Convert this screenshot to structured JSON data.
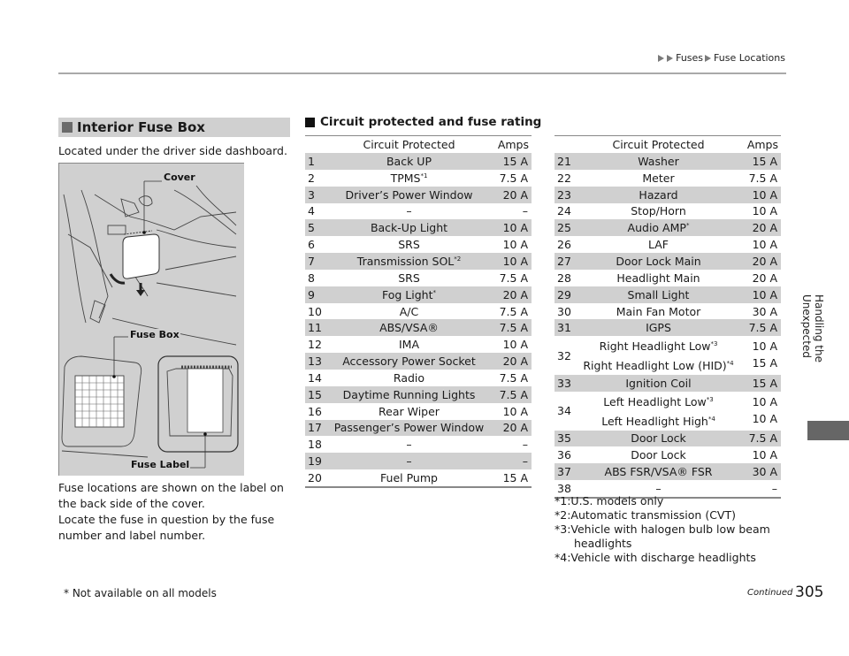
{
  "breadcrumb": {
    "items": [
      "Fuses",
      "Fuse Locations"
    ]
  },
  "left": {
    "section_title": "Interior Fuse Box",
    "intro": "Located under the driver side dashboard.",
    "figure_labels": {
      "cover": "Cover",
      "fuse_box": "Fuse Box",
      "fuse_label": "Fuse Label"
    },
    "notes": [
      "Fuse locations are shown on the label on the back side of the cover.",
      "Locate the fuse in question by the fuse number and label number."
    ]
  },
  "right": {
    "subsection_title": "Circuit protected and fuse rating",
    "columns": {
      "circuit": "Circuit Protected",
      "amps": "Amps"
    },
    "table_left": [
      {
        "num": "1",
        "circuit": "Back UP",
        "amps": "15 A"
      },
      {
        "num": "2",
        "circuit": "TPMS",
        "sup": "*1",
        "amps": "7.5 A"
      },
      {
        "num": "3",
        "circuit": "Driver’s Power Window",
        "amps": "20 A"
      },
      {
        "num": "4",
        "circuit": "–",
        "amps": "–"
      },
      {
        "num": "5",
        "circuit": "Back-Up Light",
        "amps": "10 A"
      },
      {
        "num": "6",
        "circuit": "SRS",
        "amps": "10 A"
      },
      {
        "num": "7",
        "circuit": "Transmission SOL",
        "sup": "*2",
        "amps": "10 A"
      },
      {
        "num": "8",
        "circuit": "SRS",
        "amps": "7.5 A"
      },
      {
        "num": "9",
        "circuit": "Fog Light",
        "sup": "*",
        "amps": "20 A"
      },
      {
        "num": "10",
        "circuit": "A/C",
        "amps": "7.5 A"
      },
      {
        "num": "11",
        "circuit": "ABS/VSA®",
        "amps": "7.5 A"
      },
      {
        "num": "12",
        "circuit": "IMA",
        "amps": "10 A"
      },
      {
        "num": "13",
        "circuit": "Accessory Power Socket",
        "amps": "20 A"
      },
      {
        "num": "14",
        "circuit": "Radio",
        "amps": "7.5 A"
      },
      {
        "num": "15",
        "circuit": "Daytime Running Lights",
        "amps": "7.5 A"
      },
      {
        "num": "16",
        "circuit": "Rear Wiper",
        "amps": "10 A"
      },
      {
        "num": "17",
        "circuit": "Passenger’s Power Window",
        "amps": "20 A"
      },
      {
        "num": "18",
        "circuit": "–",
        "amps": "–"
      },
      {
        "num": "19",
        "circuit": "–",
        "amps": "–"
      },
      {
        "num": "20",
        "circuit": "Fuel Pump",
        "amps": "15 A"
      }
    ],
    "table_right": [
      {
        "num": "21",
        "circuit": "Washer",
        "amps": "15 A"
      },
      {
        "num": "22",
        "circuit": "Meter",
        "amps": "7.5 A"
      },
      {
        "num": "23",
        "circuit": "Hazard",
        "amps": "10 A"
      },
      {
        "num": "24",
        "circuit": "Stop/Horn",
        "amps": "10 A"
      },
      {
        "num": "25",
        "circuit": "Audio AMP",
        "sup": "*",
        "amps": "20 A"
      },
      {
        "num": "26",
        "circuit": "LAF",
        "amps": "10 A"
      },
      {
        "num": "27",
        "circuit": "Door Lock Main",
        "amps": "20 A"
      },
      {
        "num": "28",
        "circuit": "Headlight Main",
        "amps": "20 A"
      },
      {
        "num": "29",
        "circuit": "Small Light",
        "amps": "10 A"
      },
      {
        "num": "30",
        "circuit": "Main Fan Motor",
        "amps": "30 A"
      },
      {
        "num": "31",
        "circuit": "IGPS",
        "amps": "7.5 A"
      },
      {
        "num": "32",
        "lines": [
          {
            "circuit": "Right Headlight Low",
            "sup": "*3",
            "amps": "10 A"
          },
          {
            "circuit": "Right Headlight Low (HID)",
            "sup": "*4",
            "amps": "15 A"
          }
        ]
      },
      {
        "num": "33",
        "circuit": "Ignition Coil",
        "amps": "15 A"
      },
      {
        "num": "34",
        "lines": [
          {
            "circuit": "Left Headlight Low",
            "sup": "*3",
            "amps": "10 A"
          },
          {
            "circuit": "Left Headlight High",
            "sup": "*4",
            "amps": "10 A"
          }
        ]
      },
      {
        "num": "35",
        "circuit": "Door Lock",
        "amps": "7.5 A"
      },
      {
        "num": "36",
        "circuit": "Door Lock",
        "amps": "10 A"
      },
      {
        "num": "37",
        "circuit": "ABS FSR/VSA® FSR",
        "amps": "30 A"
      },
      {
        "num": "38",
        "circuit": "–",
        "amps": "–"
      }
    ],
    "footnotes": [
      {
        "mark": "*1:",
        "text": "U.S. models only"
      },
      {
        "mark": "*2:",
        "text": "Automatic transmission (CVT)"
      },
      {
        "mark": "*3:",
        "text": "Vehicle with halogen bulb low beam",
        "cont": "headlights"
      },
      {
        "mark": "*4:",
        "text": "Vehicle with discharge headlights"
      }
    ]
  },
  "footer": {
    "note": "* Not available on all models",
    "continued": "Continued",
    "page_number": "305"
  },
  "side_tab": {
    "label": "Handling the Unexpected"
  }
}
